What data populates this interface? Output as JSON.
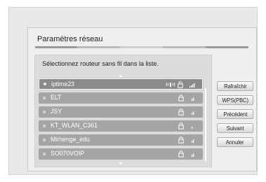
{
  "dialog": {
    "title": "Paramètres réseau",
    "progress_colors": [
      "#9a9a9a",
      "#bcbcbc",
      "#d0d0d0",
      "#bcbcbc",
      "#9a9a9a"
    ]
  },
  "list": {
    "prompt": "Sélectionnez routeur sans fil dans la liste.",
    "items": [
      {
        "ssid": "iptime23",
        "selected": true,
        "wps": true,
        "lock": true,
        "signal_icon": "signal-icon"
      },
      {
        "ssid": "ELT",
        "selected": false,
        "wps": false,
        "lock": true,
        "signal_icon": "signal-icon"
      },
      {
        "ssid": "JSY",
        "selected": false,
        "wps": false,
        "lock": true,
        "signal_icon": "signal-icon"
      },
      {
        "ssid": "KT_WLAN_C361",
        "selected": false,
        "wps": false,
        "lock": true,
        "signal_icon": "signal-icon"
      },
      {
        "ssid": "Mirhenge_edu",
        "selected": false,
        "wps": false,
        "lock": true,
        "signal_icon": "signal-icon"
      },
      {
        "ssid": "SO070VOIP",
        "selected": false,
        "wps": false,
        "lock": true,
        "signal_icon": "signal-icon"
      }
    ]
  },
  "buttons": {
    "refresh": "Rafraîchir",
    "wps": "WPS(PBC)",
    "previous": "Précédent",
    "next": "Suivant",
    "cancel": "Annuler"
  },
  "colors": {
    "row": "#a5a5a5",
    "row_selected": "#8b8b8b",
    "text": "#ffffff"
  }
}
